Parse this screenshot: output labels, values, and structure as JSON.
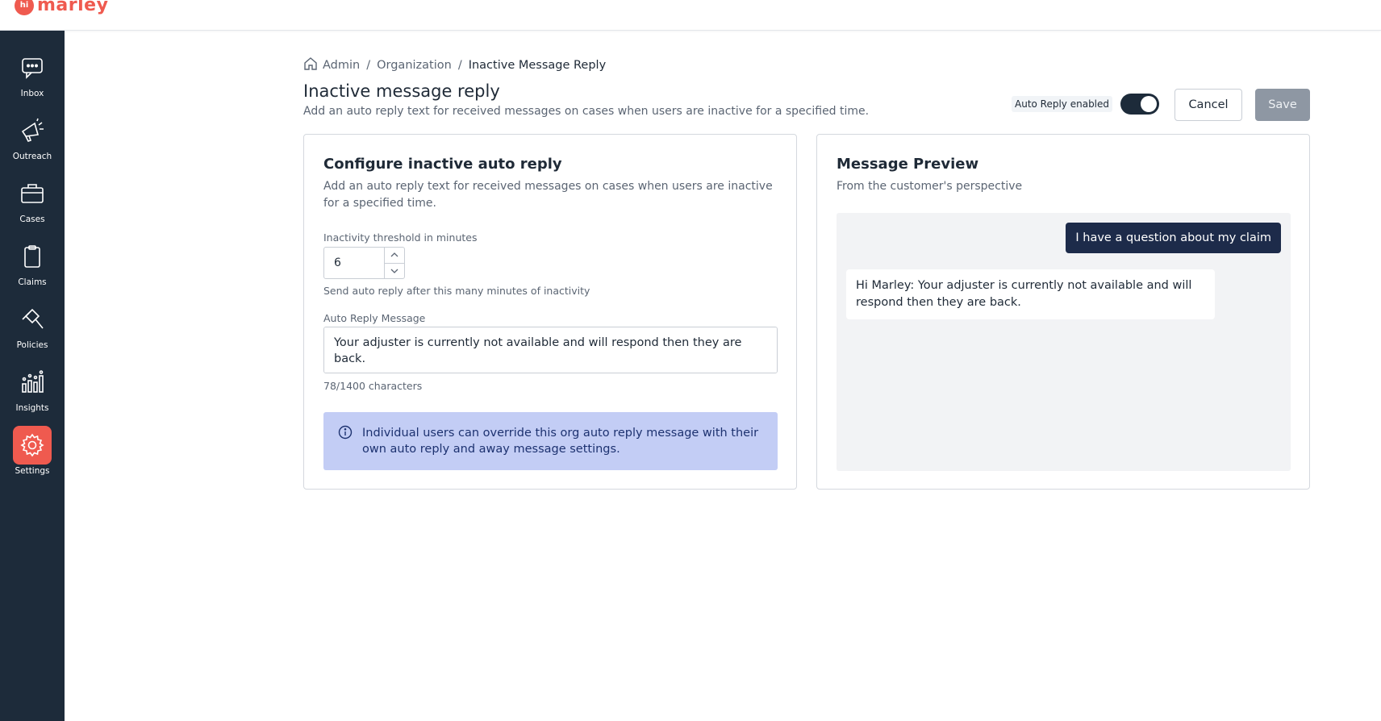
{
  "brand": {
    "badge": "hi",
    "name": "marley"
  },
  "sidebar": {
    "items": [
      {
        "label": "Inbox",
        "icon": "inbox-icon"
      },
      {
        "label": "Outreach",
        "icon": "megaphone-icon"
      },
      {
        "label": "Cases",
        "icon": "briefcase-icon"
      },
      {
        "label": "Claims",
        "icon": "clipboard-icon"
      },
      {
        "label": "Policies",
        "icon": "gavel-icon"
      },
      {
        "label": "Insights",
        "icon": "bar-chart-icon"
      },
      {
        "label": "Settings",
        "icon": "gear-icon",
        "active": true
      }
    ]
  },
  "breadcrumb": {
    "items": [
      "Admin",
      "Organization",
      "Inactive Message Reply"
    ],
    "separator": "/"
  },
  "header": {
    "title": "Inactive message reply",
    "subtitle": "Add an auto reply text for received messages on cases when users are inactive for a specified time.",
    "toggle_label": "Auto Reply enabled",
    "toggle_on": true,
    "cancel_label": "Cancel",
    "save_label": "Save"
  },
  "config": {
    "title": "Configure inactive auto reply",
    "subtitle": "Add an auto reply text for received messages on cases when users are inactive for a specified time.",
    "threshold_label": "Inactivity threshold in minutes",
    "threshold_value": "6",
    "threshold_helper": "Send auto reply after this many minutes of inactivity",
    "message_label": "Auto Reply Message",
    "message_value": "Your adjuster is currently not available and will respond then they are back.",
    "char_count": "78/1400 characters",
    "info_text": "Individual users can override this org auto reply message with their own auto reply and away message settings."
  },
  "preview": {
    "title": "Message Preview",
    "subtitle": "From the customer's perspective",
    "customer_message": "I have a question about my claim",
    "reply_message": "Hi Marley: Your adjuster is currently not available and will respond then they are back."
  },
  "colors": {
    "brand": "#ef5a4f",
    "sidebar": "#1d2b3a",
    "info_bg": "#c3cdf5",
    "bubble_out": "#1d2b4a"
  }
}
